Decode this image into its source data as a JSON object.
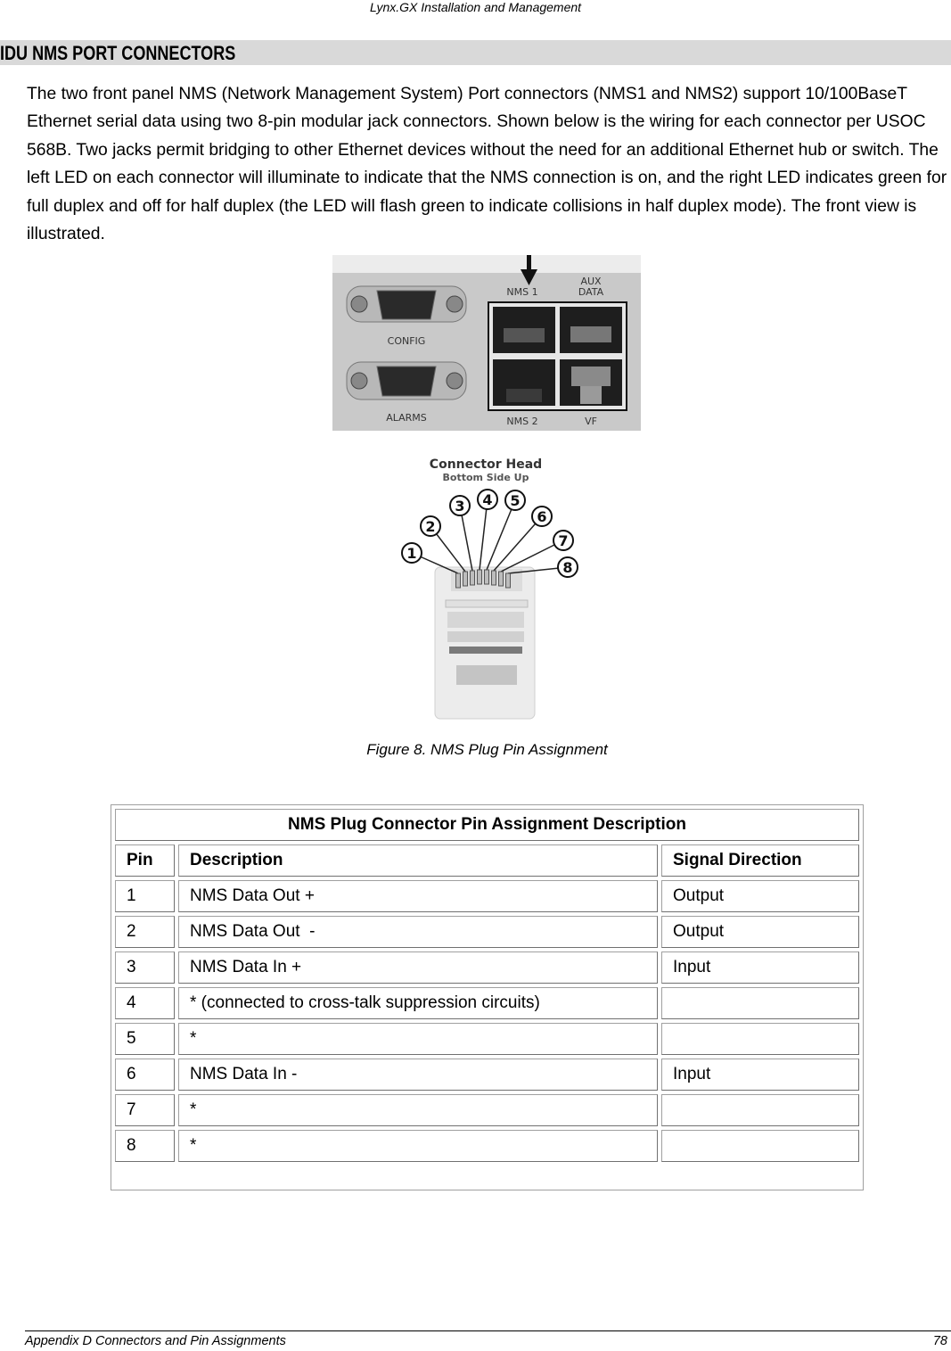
{
  "header": {
    "running_title": "Lynx.GX Installation and Management"
  },
  "section": {
    "title": "IDU NMS PORT CONNECTORS"
  },
  "body_paragraph": "The two front panel NMS (Network Management System) Port connectors (NMS1 and NMS2) support 10/100BaseT Ethernet serial data using two 8-pin modular jack connectors.  Shown below is the wiring for each connector per USOC 568B.  Two jacks permit bridging to other Ethernet devices without the need for an additional Ethernet hub or switch. The left LED on each connector will illuminate to indicate that the NMS connection is on, and the right LED indicates green for full duplex and off for half duplex (the LED will flash green to indicate collisions in half duplex mode). The front view is illustrated.",
  "panel_photo": {
    "labels": {
      "config": "CONFIG",
      "alarms": "ALARMS",
      "nms1": "NMS 1",
      "aux_data_line1": "AUX",
      "aux_data_line2": "DATA",
      "nms2": "NMS 2",
      "vf": "VF"
    }
  },
  "connector_figure": {
    "title_line1": "Connector Head",
    "title_line2": "Bottom Side Up",
    "pin_numbers": [
      "1",
      "2",
      "3",
      "4",
      "5",
      "6",
      "7",
      "8"
    ]
  },
  "figure_caption": "Figure 8.  NMS Plug Pin Assignment",
  "pin_table": {
    "title": "NMS Plug Connector Pin Assignment Description",
    "columns": [
      "Pin",
      "Description",
      "Signal Direction"
    ],
    "rows": [
      {
        "pin": "1",
        "description": "NMS Data Out +",
        "direction": "Output"
      },
      {
        "pin": "2",
        "description": "NMS Data Out  -",
        "direction": "Output"
      },
      {
        "pin": "3",
        "description": "NMS Data In +",
        "direction": "Input"
      },
      {
        "pin": "4",
        "description": "* (connected to cross-talk suppression circuits)",
        "direction": ""
      },
      {
        "pin": "5",
        "description": "*",
        "direction": ""
      },
      {
        "pin": "6",
        "description": "NMS Data In -",
        "direction": "Input"
      },
      {
        "pin": "7",
        "description": "*",
        "direction": ""
      },
      {
        "pin": "8",
        "description": "*",
        "direction": ""
      }
    ]
  },
  "footer": {
    "left": "Appendix D  Connectors and Pin Assignments",
    "page_number": "78"
  }
}
